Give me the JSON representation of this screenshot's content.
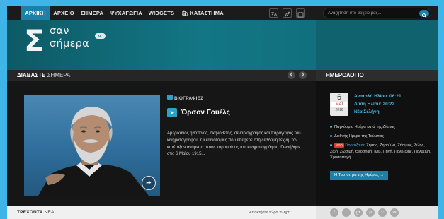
{
  "nav": {
    "items": [
      "ΑΡΧΙΚΗ",
      "ΑΡΧΕΙΟ",
      "ΣΗΜΕΡΑ",
      "ΨΥΧΑΓΩΓΙΑ",
      "WIDGETS",
      "ΚΑΤΑΣΤΗΜΑ"
    ],
    "active": "ΑΡΧΙΚΗ",
    "icons": [
      "translate-icon",
      "edit-icon",
      "calendar-icon"
    ]
  },
  "search": {
    "placeholder": "Αναζήτηση στο αρχείο μας..."
  },
  "logo": {
    "mark": "Σ",
    "line1": "σαν",
    "line2": "σήμερα",
    "badge": "gr"
  },
  "section": {
    "title_bold": "ΔΙΑΒΑΣΤΕ",
    "title_rest": " ΣΗΜΕΡΑ",
    "prev_icon": "chevron-left-icon",
    "next_icon": "chevron-right-icon"
  },
  "article": {
    "category": "ΒΙΟΓΡΑΦΙΕΣ",
    "title": "Όρσον Γουέλς",
    "excerpt": "Αμερικανός ηθοποιός, σκηνοθέτης, σεναριογράφος και παραγωγός του κινηματογράφου. Οι καινοτομίες που επέφερε στην έβδομη τέχνη, τον κατέταξαν ανάμεσα στους κορυφαίους του κινηματογράφου. Γεννήθηκε στις 6 Μαΐου 1915...",
    "share_icon": "share-icon"
  },
  "sidebar": {
    "title": "ΗΜΕΡΟΛΟΓΙΟ",
    "date": {
      "day": "6",
      "month": "ΜΑΪ",
      "year": "2016"
    },
    "sunrise": "Ανατολή Ηλίου: 06:21",
    "sunset": "Δύση Ηλίου: 20:22",
    "moon": "Νέα Σελήνη",
    "events": [
      "Παγκόσμια Ημέρα κατά της Δίαιτας",
      "Διεθνής Ημέρα της Τούμπας"
    ],
    "names_tag": "ΝΕΟ",
    "names_label": "Γιορτάζουν:",
    "names": "Ζήσης, Ζησούλα, Ζήσιμος, Ζώης, Ζωή, Ζωσιμή, Θεοσηφή, Ιώβ, Πηγή, Πολυζώης, Πολυζώη, Χρυσοπηγή",
    "cta": "Η Ταυτότητα της Ημέρας →"
  },
  "footer": {
    "label_bold": "ΤΡΕΧΟΝΤΑ",
    "label_rest": " ΝΕΑ:",
    "latest_link": "Αποκτήστε τώρα πλήρη",
    "social_icons": [
      "facebook-icon",
      "twitter-icon",
      "googleplus-icon",
      "pinterest-icon",
      "rss-icon",
      "email-icon"
    ]
  },
  "colors": {
    "accent": "#1e7fa8",
    "header_teal": "#137684",
    "page_bg": "#3fb4e6"
  }
}
